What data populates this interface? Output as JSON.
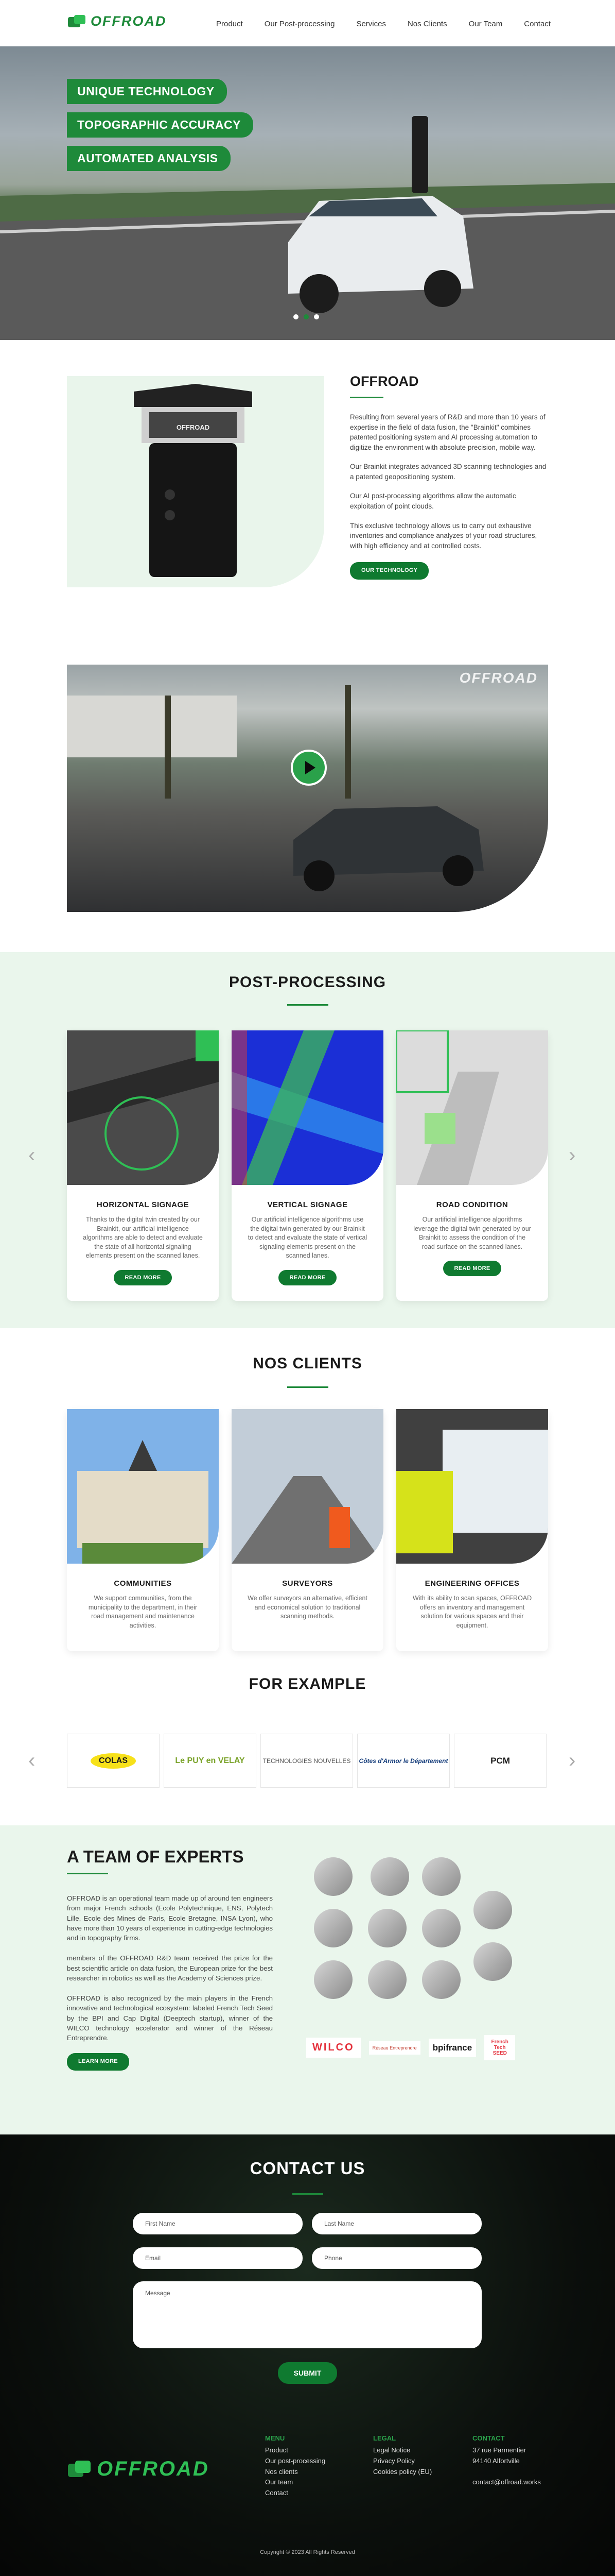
{
  "brand": {
    "name": "OFFROAD",
    "accent": "#1e8a3a"
  },
  "nav": {
    "items": [
      "Product",
      "Our Post-processing",
      "Services",
      "Nos Clients",
      "Our Team",
      "Contact"
    ]
  },
  "hero": {
    "tags": [
      "UNIQUE TECHNOLOGY",
      "TOPOGRAPHIC ACCURACY",
      "AUTOMATED ANALYSIS"
    ],
    "slides": 3,
    "active_slide": 2
  },
  "about": {
    "title": "OFFROAD",
    "paragraphs": [
      "Resulting from several years of R&D and more than 10 years of expertise in the field of data fusion, the \"Brainkit\" combines patented positioning system and AI processing automation to digitize the environment with absolute precision, mobile way.",
      "Our Brainkit integrates advanced 3D scanning technologies and a patented geopositioning system.",
      "Our AI post-processing algorithms allow the automatic exploitation of point clouds.",
      "This exclusive technology allows us to carry out exhaustive inventories and compliance analyzes of your road structures, with high efficiency and at controlled costs."
    ],
    "button": "OUR TECHNOLOGY",
    "device_label": "OFFROAD"
  },
  "video": {
    "watermark": "OFFROAD"
  },
  "post": {
    "title": "POST-PROCESSING",
    "cards": [
      {
        "title": "HORIZONTAL SIGNAGE",
        "text": "Thanks to the digital twin created by our Brainkit, our artificial intelligence algorithms are able to detect and evaluate the state of all horizontal signaling elements present on the scanned lanes.",
        "button": "READ MORE"
      },
      {
        "title": "VERTICAL SIGNAGE",
        "text": "Our artificial intelligence algorithms use the digital twin generated by our Brainkit to detect and evaluate the state of vertical signaling elements present on the scanned lanes.",
        "button": "READ MORE"
      },
      {
        "title": "ROAD CONDITION",
        "text": "Our artificial intelligence algorithms leverage the digital twin generated by our Brainkit to assess the condition of the road surface on the scanned lanes.",
        "button": "READ MORE"
      }
    ]
  },
  "clients": {
    "title": "NOS CLIENTS",
    "cards": [
      {
        "title": "COMMUNITIES",
        "text": "We support communities, from the municipality to the department, in their road management and maintenance activities."
      },
      {
        "title": "SURVEYORS",
        "text": "We offer surveyors an alternative, efficient and economical solution to traditional scanning methods."
      },
      {
        "title": "ENGINEERING OFFICES",
        "text": "With its ability to scan spaces, OFFROAD offers an inventory and management solution for various spaces and their equipment."
      }
    ]
  },
  "example": {
    "title": "FOR EXAMPLE",
    "logos": [
      "COLAS",
      "Le PUY en VELAY",
      "TECHNOLOGIES NOUVELLES",
      "Côtes d'Armor le Département",
      "PCM"
    ]
  },
  "team": {
    "title": "A TEAM OF EXPERTS",
    "paragraphs": [
      "OFFROAD is an operational team made up of around ten engineers from major French schools (Ecole Polytechnique, ENS, Polytech Lille, Ecole des Mines de Paris, Ecole Bretagne, INSA Lyon), who have more than 10 years of experience in cutting-edge technologies and in topography firms.",
      "members of the OFFROAD R&D team received the prize for the best scientific article on data fusion, the European prize for the best researcher in robotics as well as the Academy of Sciences prize.",
      "OFFROAD is also recognized by the main players in the French innovative and technological ecosystem: labeled French Tech Seed by the BPI and Cap Digital (Deeptech startup), winner of the WILCO technology accelerator and winner of the Réseau Entreprendre."
    ],
    "button": "LEARN MORE",
    "partners": [
      "WILCO",
      "Réseau Entreprendre",
      "bpifrance",
      "French Tech SEED"
    ]
  },
  "contact": {
    "title": "CONTACT US",
    "fields": {
      "first_name": "First Name",
      "last_name": "Last Name",
      "email": "Email",
      "phone": "Phone",
      "message": "Message"
    },
    "submit": "SUBMIT"
  },
  "footer": {
    "menu_title": "MENU",
    "menu": [
      "Product",
      "Our post-processing",
      "Nos clients",
      "Our team",
      "Contact"
    ],
    "legal_title": "LEGAL",
    "legal": [
      "Legal Notice",
      "Privacy Policy",
      "Cookies policy (EU)"
    ],
    "contact_title": "CONTACT",
    "address": [
      "37 rue Parmentier",
      "94140 Alfortville"
    ],
    "email": "contact@offroad.works",
    "copyright": "Copyright © 2023 All Rights Reserved"
  }
}
